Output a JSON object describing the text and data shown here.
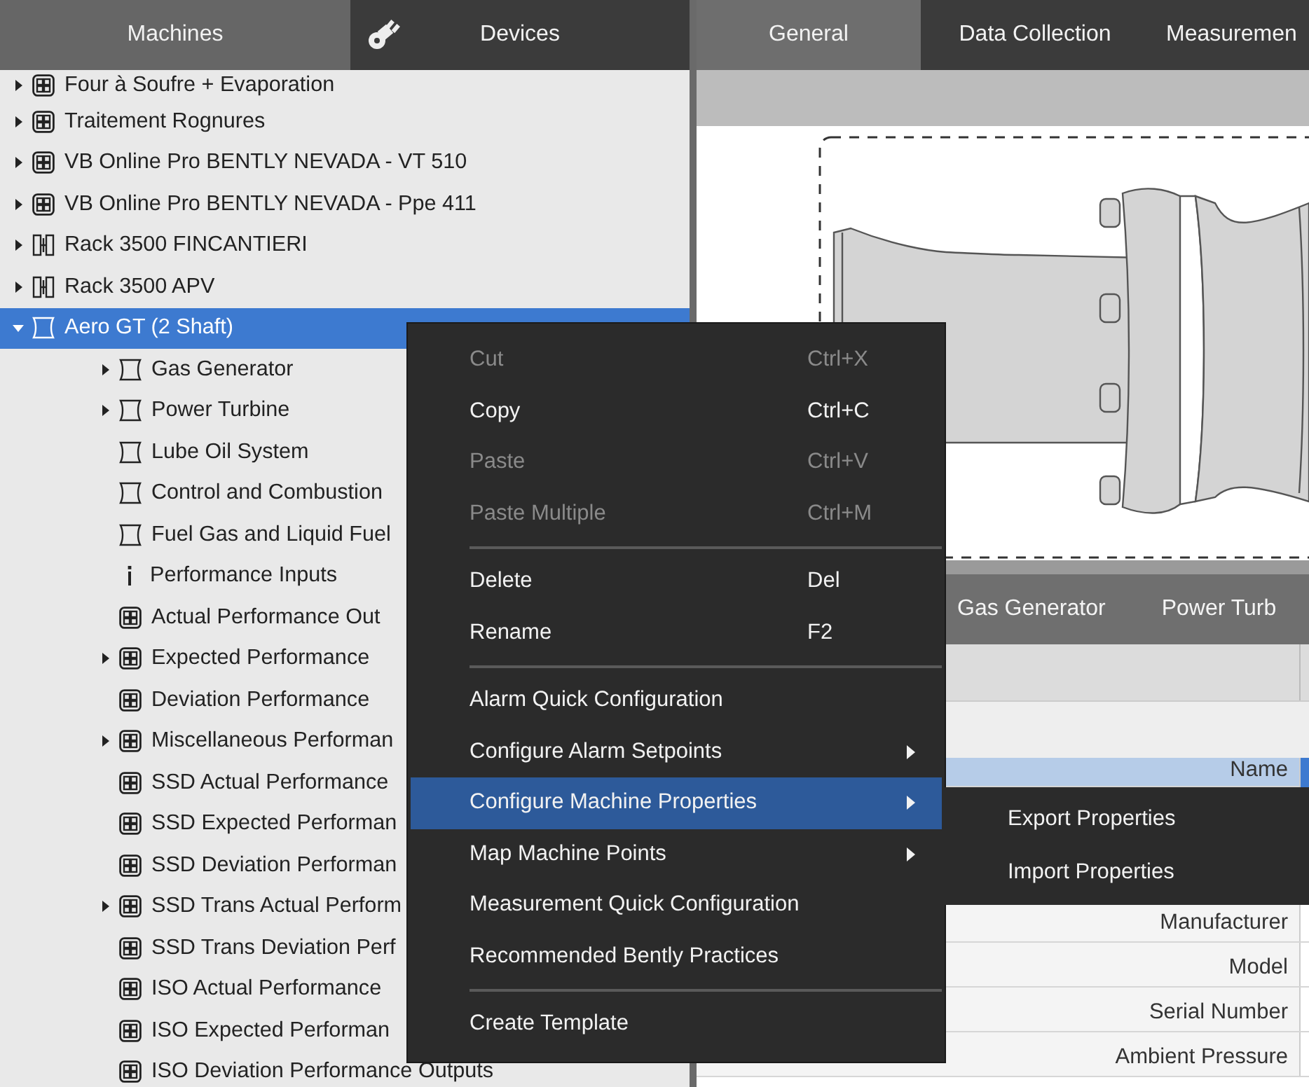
{
  "left_tabs": [
    {
      "label": "Machines",
      "selected": true,
      "kind": "text"
    },
    {
      "label": "Devices",
      "selected": false,
      "kind": "icon_text"
    }
  ],
  "tree": {
    "items": [
      {
        "label": "Four à Soufre + Evaporation",
        "kind": "grid",
        "expanded": false,
        "selected": false
      },
      {
        "label": "Traitement Rognures",
        "kind": "grid",
        "expanded": false,
        "selected": false
      },
      {
        "label": "VB Online Pro BENTLY NEVADA - VT 510",
        "kind": "grid",
        "expanded": false,
        "selected": false
      },
      {
        "label": "VB Online Pro BENTLY NEVADA - Ppe 411",
        "kind": "grid",
        "expanded": false,
        "selected": false
      },
      {
        "label": "Rack 3500 FINCANTIERI",
        "kind": "rack",
        "expanded": false,
        "selected": false
      },
      {
        "label": "Rack 3500 APV",
        "kind": "rack",
        "expanded": false,
        "selected": false
      },
      {
        "label": "Aero GT (2 Shaft)",
        "kind": "machine",
        "expanded": true,
        "selected": true,
        "children": [
          {
            "label": "Gas Generator",
            "kind": "machine",
            "expanded": false,
            "selected": false
          },
          {
            "label": "Power Turbine",
            "kind": "machine",
            "expanded": false,
            "selected": false
          },
          {
            "label": "Lube Oil System",
            "kind": "machine",
            "selected": false
          },
          {
            "label": "Control and Combustion",
            "kind": "machine",
            "selected": false
          },
          {
            "label": "Fuel Gas and Liquid Fuel",
            "kind": "machine",
            "selected": false
          },
          {
            "label": "Performance Inputs",
            "kind": "info",
            "selected": false
          },
          {
            "label": "Actual Performance Out",
            "kind": "grid",
            "selected": false
          },
          {
            "label": "Expected Performance",
            "kind": "grid",
            "expanded": false,
            "selected": false
          },
          {
            "label": "Deviation Performance",
            "kind": "grid",
            "selected": false
          },
          {
            "label": "Miscellaneous Performan",
            "kind": "grid",
            "expanded": false,
            "selected": false
          },
          {
            "label": "SSD Actual Performance",
            "kind": "grid",
            "selected": false
          },
          {
            "label": "SSD Expected Performan",
            "kind": "grid",
            "selected": false
          },
          {
            "label": "SSD Deviation Performan",
            "kind": "grid",
            "selected": false
          },
          {
            "label": "SSD Trans Actual Perform",
            "kind": "grid",
            "expanded": false,
            "selected": false
          },
          {
            "label": "SSD Trans Deviation Perf",
            "kind": "grid",
            "selected": false
          },
          {
            "label": "ISO Actual Performance",
            "kind": "grid",
            "selected": false
          },
          {
            "label": "ISO Expected Performan",
            "kind": "grid",
            "selected": false
          },
          {
            "label": "ISO Deviation Performance Outputs",
            "kind": "grid",
            "selected": false
          }
        ]
      }
    ]
  },
  "right_tabs": [
    {
      "label": "General",
      "selected": true
    },
    {
      "label": "Data Collection",
      "selected": false
    },
    {
      "label": "Measuremen",
      "selected": false
    }
  ],
  "component_tabs": [
    {
      "label": "Gas Generator",
      "selected": false
    },
    {
      "label": "Power Turb",
      "selected": false
    }
  ],
  "properties": [
    {
      "label": "Name",
      "selected": true
    },
    {
      "label": "Manufacturer",
      "selected": false
    },
    {
      "label": "Model",
      "selected": false
    },
    {
      "label": "Serial Number",
      "selected": false
    },
    {
      "label": "Ambient Pressure",
      "selected": false
    }
  ],
  "context_menu": [
    {
      "kind": "item",
      "label": "Cut",
      "shortcut": "Ctrl+X",
      "disabled": true,
      "submenu": false,
      "selected": false
    },
    {
      "kind": "item",
      "label": "Copy",
      "shortcut": "Ctrl+C",
      "disabled": false,
      "submenu": false,
      "selected": false
    },
    {
      "kind": "item",
      "label": "Paste",
      "shortcut": "Ctrl+V",
      "disabled": true,
      "submenu": false,
      "selected": false
    },
    {
      "kind": "item",
      "label": "Paste Multiple",
      "shortcut": "Ctrl+M",
      "disabled": true,
      "submenu": false,
      "selected": false
    },
    {
      "kind": "separator"
    },
    {
      "kind": "item",
      "label": "Delete",
      "shortcut": "Del",
      "disabled": false,
      "submenu": false,
      "selected": false
    },
    {
      "kind": "item",
      "label": "Rename",
      "shortcut": "F2",
      "disabled": false,
      "submenu": false,
      "selected": false
    },
    {
      "kind": "separator"
    },
    {
      "kind": "item",
      "label": "Alarm Quick Configuration",
      "disabled": false,
      "submenu": false,
      "selected": false
    },
    {
      "kind": "item",
      "label": "Configure Alarm Setpoints",
      "disabled": false,
      "submenu": true,
      "selected": false
    },
    {
      "kind": "item",
      "label": "Configure Machine Properties",
      "disabled": false,
      "submenu": true,
      "selected": true
    },
    {
      "kind": "item",
      "label": "Map Machine Points",
      "disabled": false,
      "submenu": true,
      "selected": false
    },
    {
      "kind": "item",
      "label": "Measurement Quick Configuration",
      "disabled": false,
      "submenu": false,
      "selected": false
    },
    {
      "kind": "item",
      "label": "Recommended Bently Practices",
      "disabled": false,
      "submenu": false,
      "selected": false
    },
    {
      "kind": "separator"
    },
    {
      "kind": "item",
      "label": "Create Template",
      "disabled": false,
      "submenu": false,
      "selected": false
    }
  ],
  "submenu": [
    {
      "label": "Export Properties"
    },
    {
      "label": "Import Properties"
    }
  ]
}
